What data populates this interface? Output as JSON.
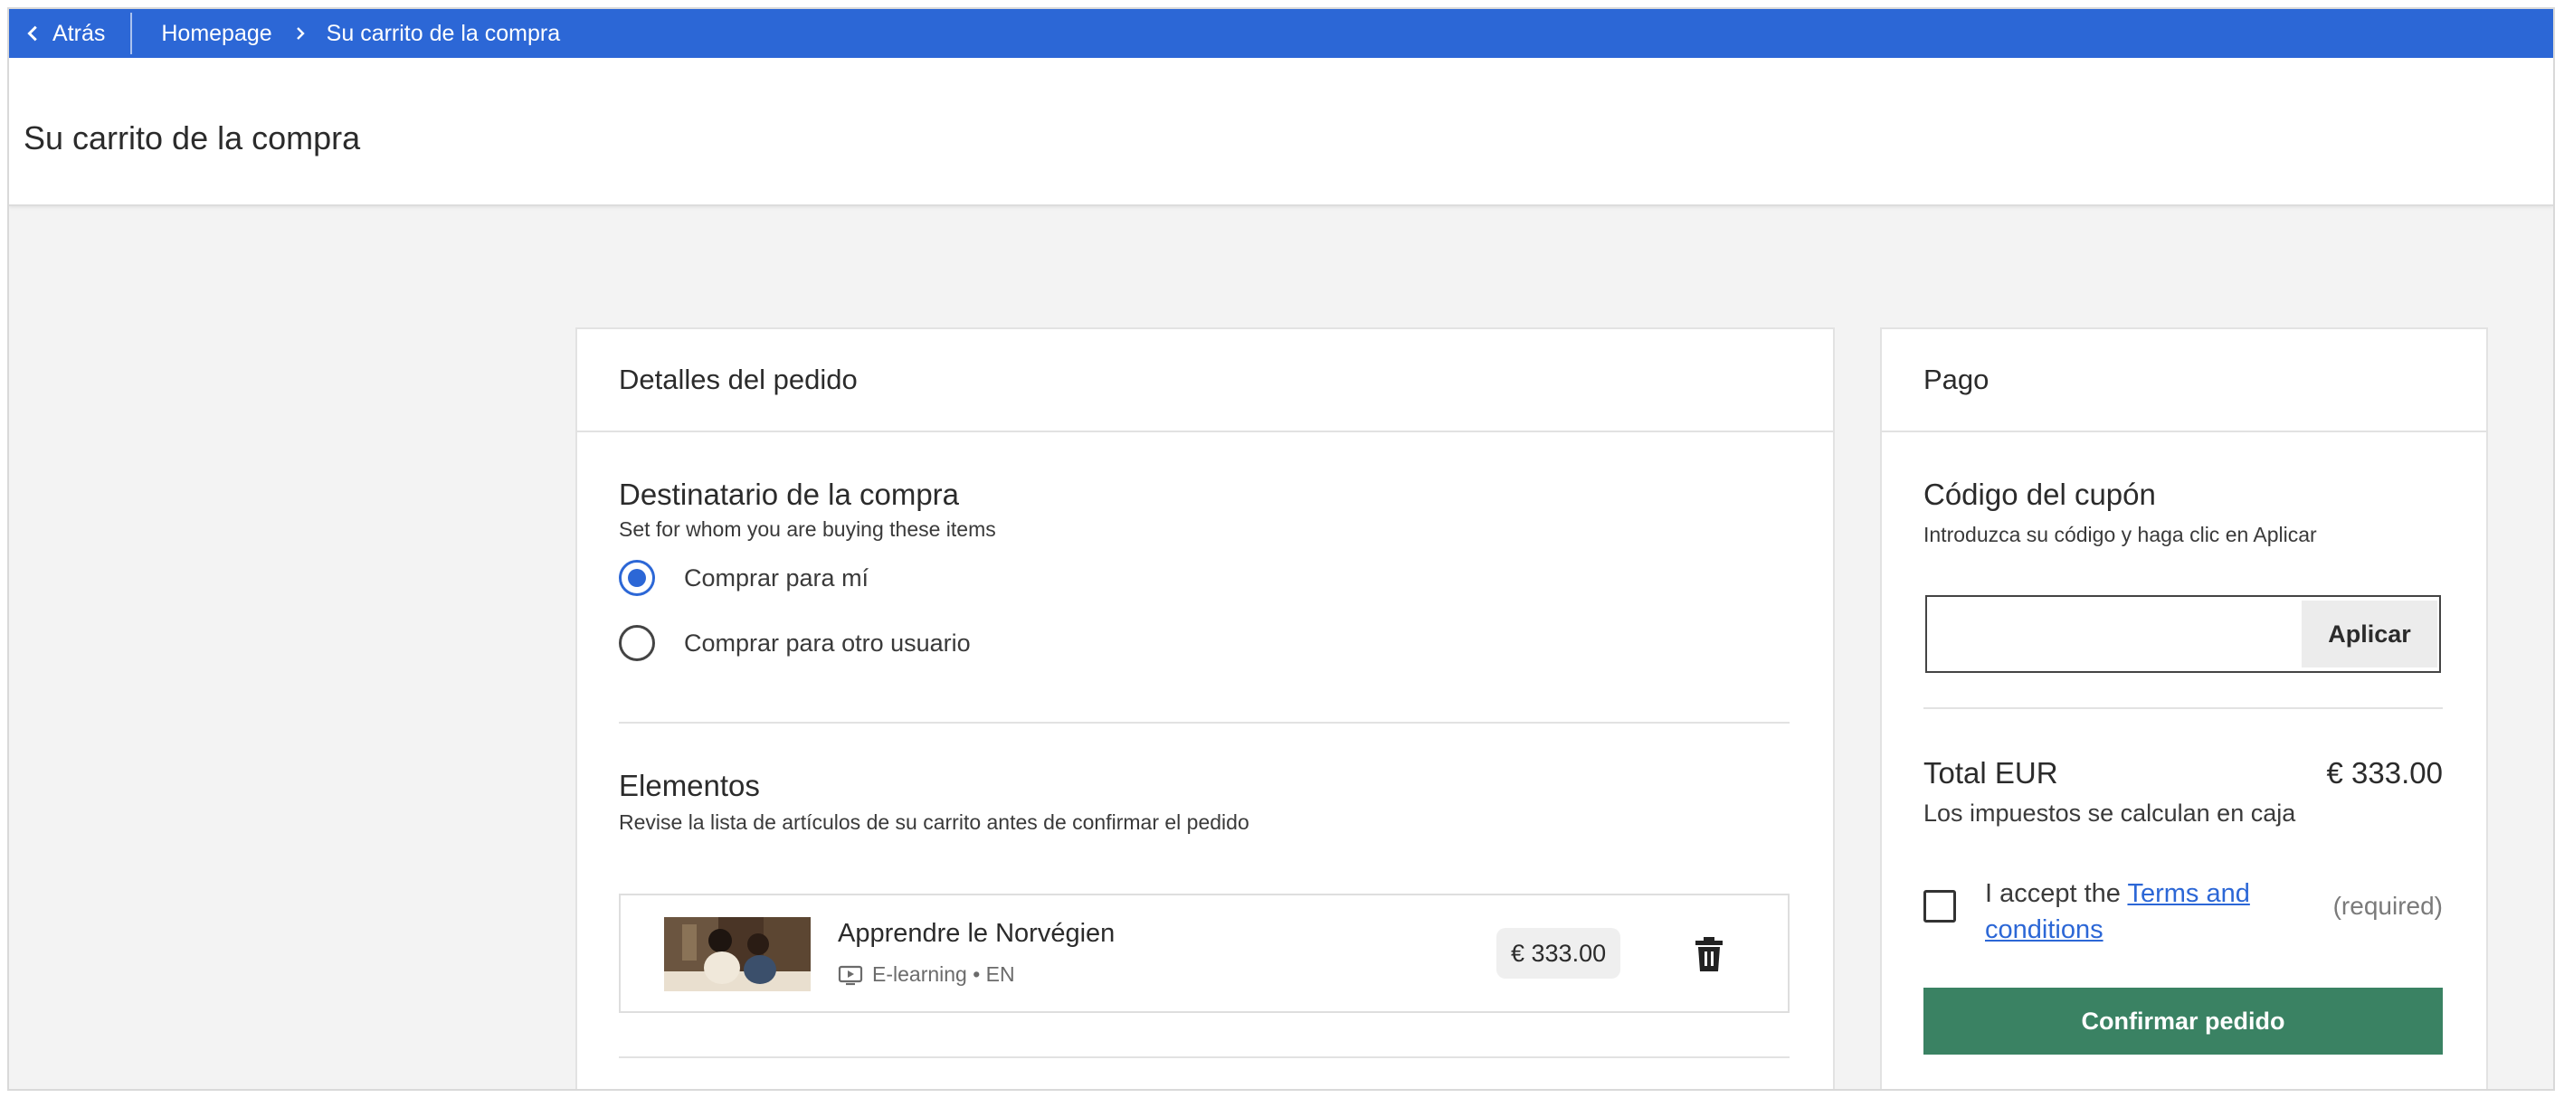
{
  "breadcrumb": {
    "back_label": "Atrás",
    "home_label": "Homepage",
    "current_label": "Su carrito de la compra"
  },
  "page": {
    "title": "Su carrito de la compra"
  },
  "order_details": {
    "heading": "Detalles del pedido",
    "recipient": {
      "title": "Destinatario de la compra",
      "subtitle": "Set for whom you are buying these items",
      "options": [
        {
          "label": "Comprar para mí",
          "selected": true
        },
        {
          "label": "Comprar para otro usuario",
          "selected": false
        }
      ]
    },
    "items_section": {
      "title": "Elementos",
      "subtitle": "Revise la lista de artículos de su carrito antes de confirmar el pedido"
    },
    "items": [
      {
        "title": "Apprendre le Norvégien",
        "type": "E-learning",
        "language": "EN",
        "meta": "E-learning • EN",
        "price": "€ 333.00",
        "type_icon": "video-play-icon",
        "remove_icon": "trash-icon"
      }
    ]
  },
  "payment": {
    "heading": "Pago",
    "coupon": {
      "title": "Código del cupón",
      "subtitle": "Introduzca su código y haga clic en Aplicar",
      "value": "",
      "apply_label": "Aplicar"
    },
    "total_label": "Total EUR",
    "total_value": "€ 333.00",
    "tax_note": "Los impuestos se calculan en caja",
    "terms_prefix": "I accept the ",
    "terms_link": "Terms and conditions",
    "required_label": "(required)",
    "terms_checked": false,
    "confirm_label": "Confirmar pedido"
  },
  "colors": {
    "primary_blue": "#2c67d6",
    "confirm_green": "#3a8263"
  }
}
